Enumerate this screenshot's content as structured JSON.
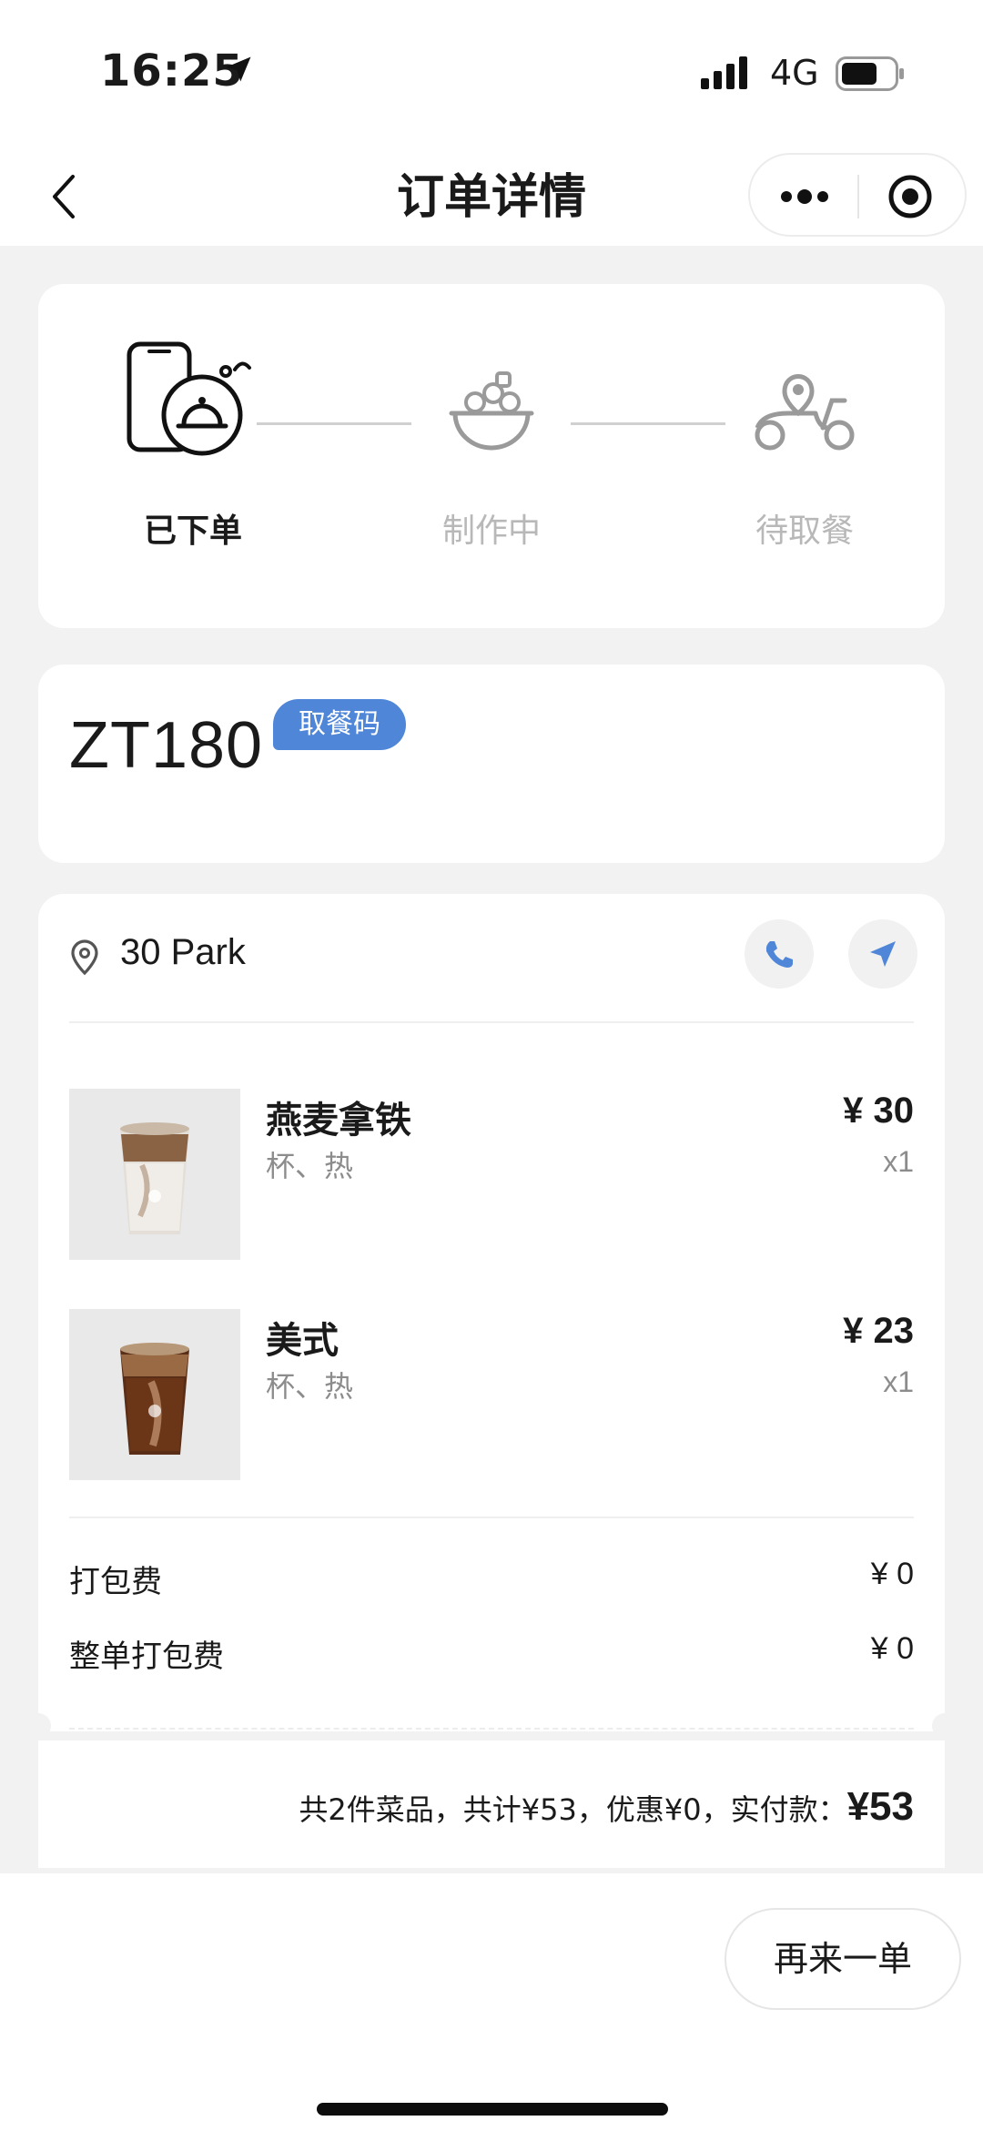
{
  "status_bar": {
    "time": "16:25",
    "network": "4G"
  },
  "nav": {
    "title": "订单详情"
  },
  "progress": {
    "steps": [
      {
        "label": "已下单",
        "active": true
      },
      {
        "label": "制作中",
        "active": false
      },
      {
        "label": "待取餐",
        "active": false
      }
    ]
  },
  "pickup": {
    "code": "ZT180",
    "badge": "取餐码"
  },
  "store": {
    "name": "30 Park"
  },
  "items": [
    {
      "name": "燕麦拿铁",
      "spec": "杯、热",
      "price": "¥ 30",
      "qty": "x1"
    },
    {
      "name": "美式",
      "spec": "杯、热",
      "price": "¥ 23",
      "qty": "x1"
    }
  ],
  "fees": [
    {
      "label": "打包费",
      "value": "¥ 0"
    },
    {
      "label": "整单打包费",
      "value": "¥ 0"
    }
  ],
  "summary": {
    "text": "共2件菜品，共计¥53，优惠¥0，实付款：",
    "total": "¥53"
  },
  "actions": {
    "reorder": "再来一单"
  },
  "colors": {
    "accent": "#4f86d8",
    "inactive": "#b8b8b8"
  }
}
